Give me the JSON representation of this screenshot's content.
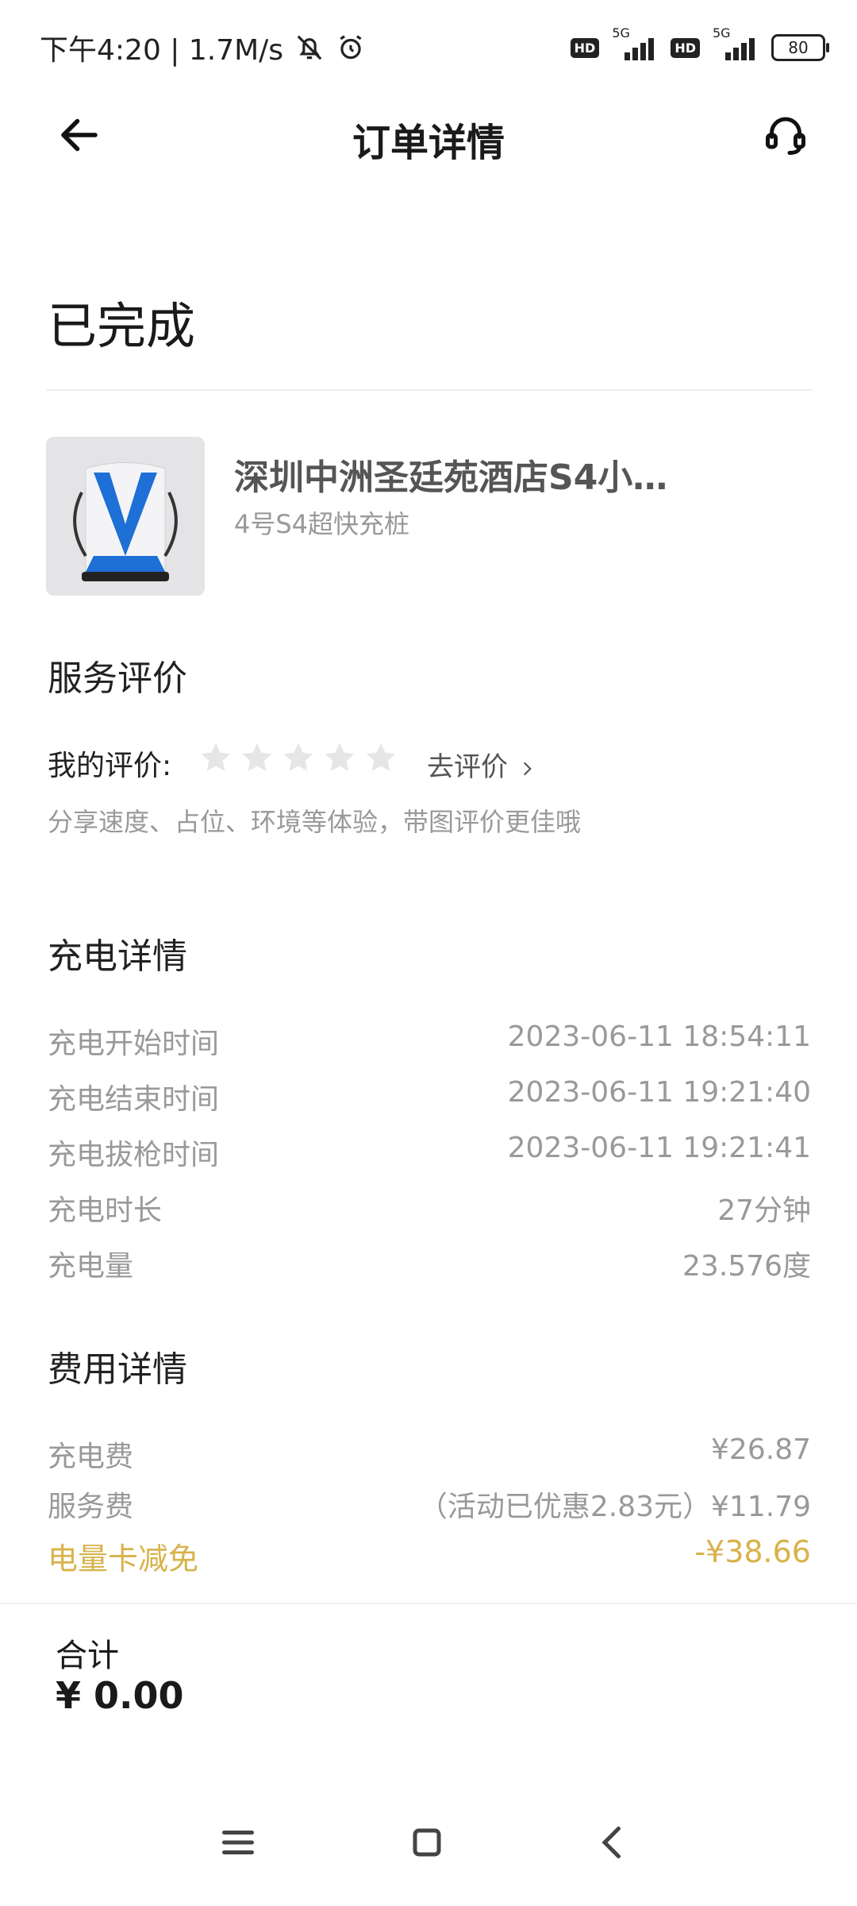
{
  "status_bar": {
    "time_speed": "下午4:20 | 1.7M/s",
    "hd1": "HD",
    "net1": "5G",
    "hd2": "HD",
    "net2": "5G",
    "battery": "80"
  },
  "header": {
    "title": "订单详情"
  },
  "order_status": "已完成",
  "station": {
    "name": "深圳中洲圣廷苑酒店S4小…",
    "pile": "4号S4超快充桩"
  },
  "service_review": {
    "section_title": "服务评价",
    "my_rating_label": "我的评价:",
    "rating": 0,
    "max_rating": 5,
    "go_rate_label": "去评价",
    "hint": "分享速度、占位、环境等体验，带图评价更佳哦"
  },
  "charging_details": {
    "section_title": "充电详情",
    "rows": [
      {
        "label": "充电开始时间",
        "value": "2023-06-11 18:54:11"
      },
      {
        "label": "充电结束时间",
        "value": "2023-06-11 19:21:40"
      },
      {
        "label": "充电拔枪时间",
        "value": "2023-06-11 19:21:41"
      },
      {
        "label": "充电时长",
        "value": "27分钟"
      },
      {
        "label": "充电量",
        "value": "23.576度"
      }
    ]
  },
  "fee_details": {
    "section_title": "费用详情",
    "rows": [
      {
        "label": "充电费",
        "value": "¥26.87"
      },
      {
        "label": "服务费",
        "value": "（活动已优惠2.83元）¥11.79"
      },
      {
        "label": "电量卡减免",
        "value": "-¥38.66"
      }
    ]
  },
  "total": {
    "label": "合计",
    "value": "¥ 0.00"
  },
  "colors": {
    "accent_gold": "#d8b24a",
    "muted_text": "#999999",
    "star_empty": "#e6e6e6"
  },
  "icons": {
    "back": "arrow-left-icon",
    "support": "headset-icon",
    "mute": "bell-off-icon",
    "alarm": "alarm-icon",
    "chevron": "chevron-right-icon",
    "nav_menu": "menu-icon",
    "nav_home": "square-icon",
    "nav_back": "chevron-left-icon"
  }
}
